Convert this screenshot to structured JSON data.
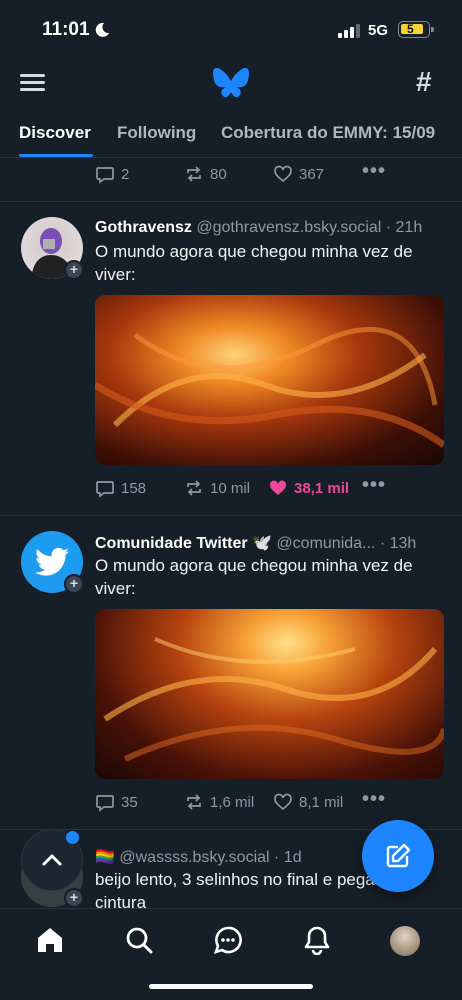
{
  "status_bar": {
    "time": "11:01",
    "network": "5G",
    "battery": "5"
  },
  "tabs": [
    {
      "label": "Discover"
    },
    {
      "label": "Following"
    },
    {
      "label": "Cobertura do EMMY: 15/09"
    }
  ],
  "prev_post": {
    "replies": "2",
    "reposts": "80",
    "likes": "367"
  },
  "posts": [
    {
      "name": "Gothravensz",
      "handle": "@gothravensz.bsky.social",
      "time": "· 21h",
      "text": "O mundo agora que chegou minha vez de viver:",
      "replies": "158",
      "reposts": "10 mil",
      "likes": "38,1 mil",
      "liked": true
    },
    {
      "name": "Comunidade Twitter",
      "handle": "@comunida...",
      "time": "· 13h",
      "text": "O mundo agora que chegou minha vez de viver:",
      "replies": "35",
      "reposts": "1,6 mil",
      "likes": "8,1 mil",
      "liked": false
    },
    {
      "name": "🏳️‍🌈",
      "handle": "@wassss.bsky.social",
      "time": "· 1d",
      "text": "beijo lento, 3 selinhos no final e pega na cintura"
    }
  ],
  "colors": {
    "accent": "#1d85ff",
    "like": "#ec4899",
    "background": "#161e27"
  },
  "icons": [
    "menu-icon",
    "butterfly-logo",
    "hash-icon",
    "reply-icon",
    "repost-icon",
    "heart-icon",
    "more-icon",
    "home-icon",
    "search-icon",
    "chat-icon",
    "bell-icon",
    "profile-avatar",
    "compose-icon",
    "chevron-up-icon"
  ]
}
